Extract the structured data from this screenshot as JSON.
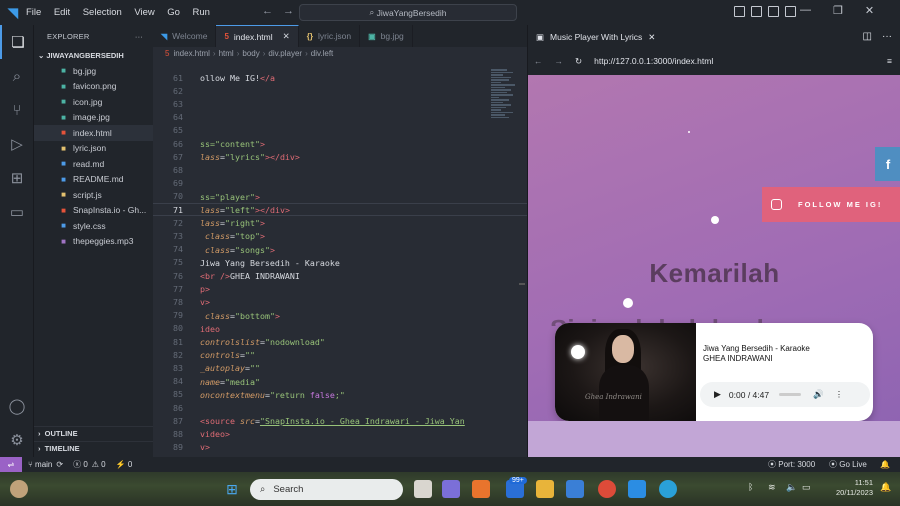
{
  "titlebar": {
    "menu": [
      "File",
      "Edit",
      "Selection",
      "View",
      "Go",
      "Run"
    ],
    "search_text": "JiwaYangBersedih"
  },
  "explorer": {
    "title": "EXPLORER",
    "folder": "JIWAYANGBERSEDIH",
    "files": [
      {
        "name": "bg.jpg",
        "icon": "image-file-icon",
        "color": "#4cb3a4"
      },
      {
        "name": "favicon.png",
        "icon": "image-file-icon",
        "color": "#4cb3a4"
      },
      {
        "name": "icon.jpg",
        "icon": "image-file-icon",
        "color": "#4cb3a4"
      },
      {
        "name": "image.jpg",
        "icon": "image-file-icon",
        "color": "#4cb3a4"
      },
      {
        "name": "index.html",
        "icon": "html-file-icon",
        "color": "#e5533a"
      },
      {
        "name": "lyric.json",
        "icon": "json-file-icon",
        "color": "#e3c16f"
      },
      {
        "name": "read.md",
        "icon": "markdown-file-icon",
        "color": "#4d9be8"
      },
      {
        "name": "README.md",
        "icon": "info-file-icon",
        "color": "#4d9be8"
      },
      {
        "name": "script.js",
        "icon": "js-file-icon",
        "color": "#e3c16f"
      },
      {
        "name": "SnapInsta.io - Gh...",
        "icon": "media-file-icon",
        "color": "#e5533a"
      },
      {
        "name": "style.css",
        "icon": "css-file-icon",
        "color": "#4d9be8"
      },
      {
        "name": "thepeggies.mp3",
        "icon": "audio-file-icon",
        "color": "#a074c4"
      }
    ],
    "outline": "OUTLINE",
    "timeline": "TIMELINE"
  },
  "editor": {
    "tabs": [
      {
        "label": "Welcome",
        "active": false
      },
      {
        "label": "index.html",
        "active": true
      },
      {
        "label": "lyric.json",
        "active": false
      },
      {
        "label": "bg.jpg",
        "active": false
      }
    ],
    "breadcrumbs": [
      "index.html",
      "html",
      "body",
      "div.player",
      "div.left"
    ],
    "line_numbers": [
      "61",
      "62",
      "63",
      "64",
      "65",
      "66",
      "67",
      "68",
      "69",
      "70",
      "71",
      "72",
      "73",
      "74",
      "75",
      "76",
      "77",
      "78",
      "79",
      "80",
      "81",
      "82",
      "83",
      "84",
      "85",
      "86",
      "87",
      "88",
      "89"
    ],
    "current_line": "71"
  },
  "browser": {
    "tab_title": "Music Player With Lyrics",
    "url": "http://127.0.0.1:3000/index.html",
    "follow_label": "FOLLOW ME IG!",
    "lyric_line": "Kemarilah",
    "lyric_next": "Sini peluk dulu aku",
    "song_title": "Jiwa Yang Bersedih - Karaoke",
    "artist": "GHEA INDRAWANI",
    "time": "0:00 / 4:47",
    "progress": 0,
    "photo_signature": "Ghea Indrawani"
  },
  "statusbar": {
    "branch": "main",
    "errors": "0",
    "warnings": "0",
    "ports": "0",
    "port": "Port: 3000",
    "golive": "Go Live"
  },
  "taskbar": {
    "search": "Search",
    "badge": "99+",
    "time": "11:51",
    "date": "20/11/2023"
  }
}
